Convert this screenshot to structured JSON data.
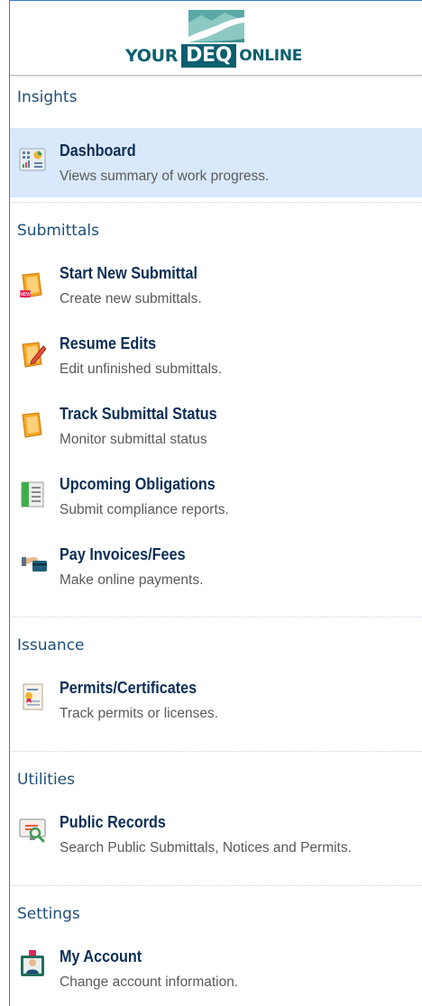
{
  "logo": {
    "word1": "YOUR",
    "word2": "DEQ",
    "word3": "ONLINE"
  },
  "sections": {
    "insights": {
      "title": "Insights",
      "items": [
        {
          "title": "Dashboard",
          "desc": "Views summary of work progress.",
          "icon": "dashboard-icon",
          "active": true
        }
      ]
    },
    "submittals": {
      "title": "Submittals",
      "items": [
        {
          "title": "Start New Submittal",
          "desc": "Create new submittals.",
          "icon": "new-submittal-icon"
        },
        {
          "title": "Resume Edits",
          "desc": "Edit unfinished submittals.",
          "icon": "edit-document-icon"
        },
        {
          "title": "Track Submittal Status",
          "desc": "Monitor submittal status",
          "icon": "track-status-icon"
        },
        {
          "title": "Upcoming Obligations",
          "desc": "Submit compliance reports.",
          "icon": "obligations-icon"
        },
        {
          "title": "Pay Invoices/Fees",
          "desc": "Make online payments.",
          "icon": "payment-icon"
        }
      ]
    },
    "issuance": {
      "title": "Issuance",
      "items": [
        {
          "title": "Permits/Certificates",
          "desc": "Track permits or licenses.",
          "icon": "certificate-icon"
        }
      ]
    },
    "utilities": {
      "title": "Utilities",
      "items": [
        {
          "title": "Public Records",
          "desc": "Search Public Submittals, Notices and Permits.",
          "icon": "public-records-icon"
        }
      ]
    },
    "settings": {
      "title": "Settings",
      "items": [
        {
          "title": "My Account",
          "desc": "Change account information.",
          "icon": "account-icon"
        }
      ]
    }
  },
  "colors": {
    "brand_teal": "#0b5f6e",
    "active_bg": "#d9e9fb",
    "title_navy": "#0d2e57",
    "section_blue": "#1f4e79"
  }
}
